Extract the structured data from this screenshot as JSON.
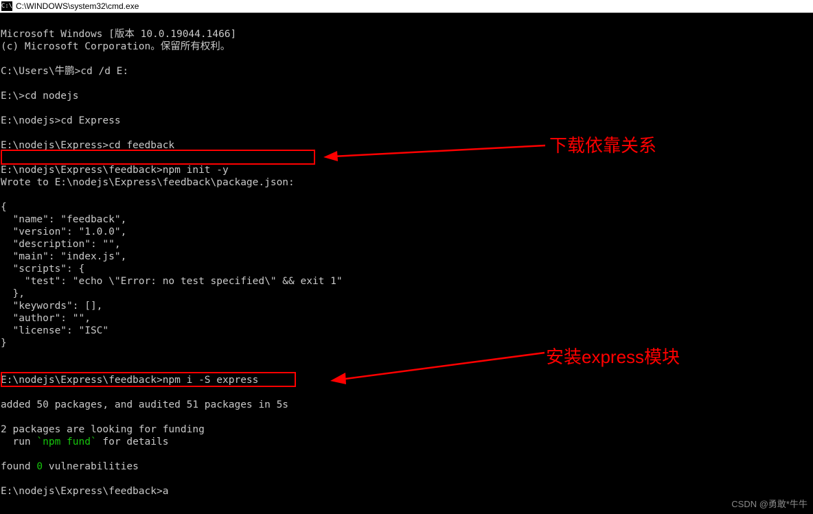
{
  "window": {
    "title": "C:\\WINDOWS\\system32\\cmd.exe",
    "icon_label": "C:\\"
  },
  "terminal": {
    "line1": "Microsoft Windows [版本 10.0.19044.1466]",
    "line2": "(c) Microsoft Corporation。保留所有权利。",
    "line3": "",
    "line4": "C:\\Users\\牛鹏>cd /d E:",
    "line5": "",
    "line6": "E:\\>cd nodejs",
    "line7": "",
    "line8": "E:\\nodejs>cd Express",
    "line9": "",
    "line10": "E:\\nodejs\\Express>cd feedback",
    "line11": "",
    "line12": "E:\\nodejs\\Express\\feedback>npm init -y",
    "line13": "Wrote to E:\\nodejs\\Express\\feedback\\package.json:",
    "line14": "",
    "line15": "{",
    "line16": "  \"name\": \"feedback\",",
    "line17": "  \"version\": \"1.0.0\",",
    "line18": "  \"description\": \"\",",
    "line19": "  \"main\": \"index.js\",",
    "line20": "  \"scripts\": {",
    "line21": "    \"test\": \"echo \\\"Error: no test specified\\\" && exit 1\"",
    "line22": "  },",
    "line23": "  \"keywords\": [],",
    "line24": "  \"author\": \"\",",
    "line25": "  \"license\": \"ISC\"",
    "line26": "}",
    "line27": "",
    "line28": "",
    "line29": "E:\\nodejs\\Express\\feedback>npm i -S express",
    "line30": "",
    "line31_a": "added 50 packages, and audited 51 packages in 5s",
    "line32": "",
    "line33_a": "2 packages are looking for funding",
    "line34_a": "  run ",
    "line34_b": "`npm fund`",
    "line34_c": " for details",
    "line35": "",
    "line36_a": "found ",
    "line36_b": "0",
    "line36_c": " vulnerabilities",
    "line37": "",
    "line38": "E:\\nodejs\\Express\\feedback>a"
  },
  "annotations": {
    "label1": "下载依靠关系",
    "label2": "安装express模块"
  },
  "watermark": "CSDN @勇敢*牛牛"
}
